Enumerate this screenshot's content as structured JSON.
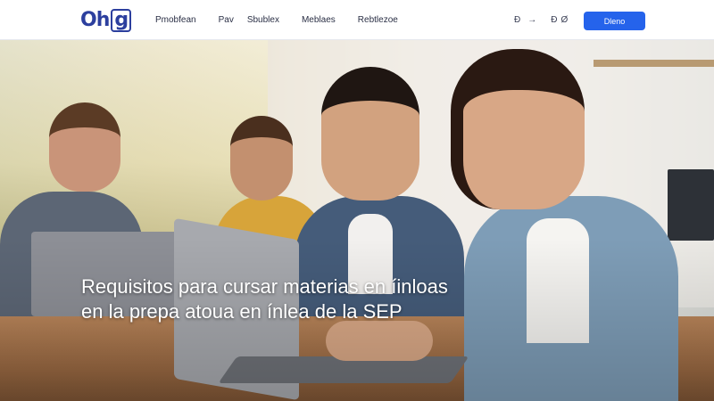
{
  "header": {
    "logo_text": "Oh",
    "logo_box": "g",
    "nav": [
      "Pmobfean",
      "Pav",
      "Sbublex",
      "Meblaes",
      "Rebtlezoe"
    ],
    "tools": [
      "Đ",
      "→",
      "Đ",
      "Ø"
    ],
    "cta_label": "Dleno"
  },
  "hero": {
    "title_line1": "Requisitos para cursar materias en íinloas",
    "title_line2": "en la prepa atoua en ínlea de la SEP"
  },
  "colors": {
    "brand": "#2c3f9e",
    "cta": "#2563eb"
  }
}
